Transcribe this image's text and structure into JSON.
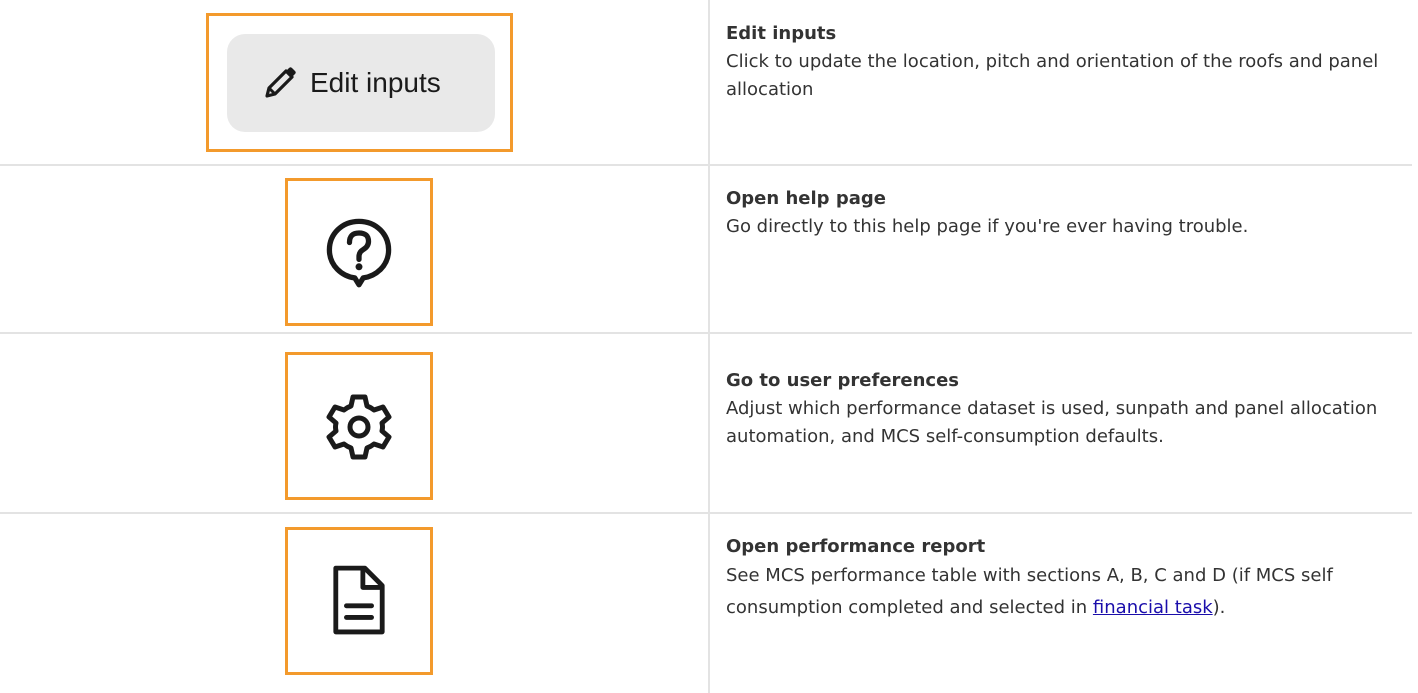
{
  "rows": [
    {
      "icon": "pencil-icon",
      "button_label": "Edit inputs",
      "title": "Edit inputs",
      "description": "Click to update the location, pitch and orientation of the roofs and panel allocation"
    },
    {
      "icon": "help-circle-icon",
      "title": "Open help page",
      "description": "Go directly to this help page if you're ever having trouble."
    },
    {
      "icon": "gear-icon",
      "title": "Go to user preferences",
      "description": "Adjust which performance dataset is used, sunpath and panel allocation automation, and MCS self-consumption defaults."
    },
    {
      "icon": "document-icon",
      "title": "Open performance report",
      "description_before": "See MCS performance table with sections A, B, C and D (if MCS self consumption completed and selected in ",
      "link_text": "financial task",
      "description_after": ")."
    }
  ],
  "colors": {
    "highlight_frame": "#f39a2c",
    "divider": "#e3e3e3",
    "link": "#1a0dab",
    "button_bg": "#e9e9e9"
  }
}
